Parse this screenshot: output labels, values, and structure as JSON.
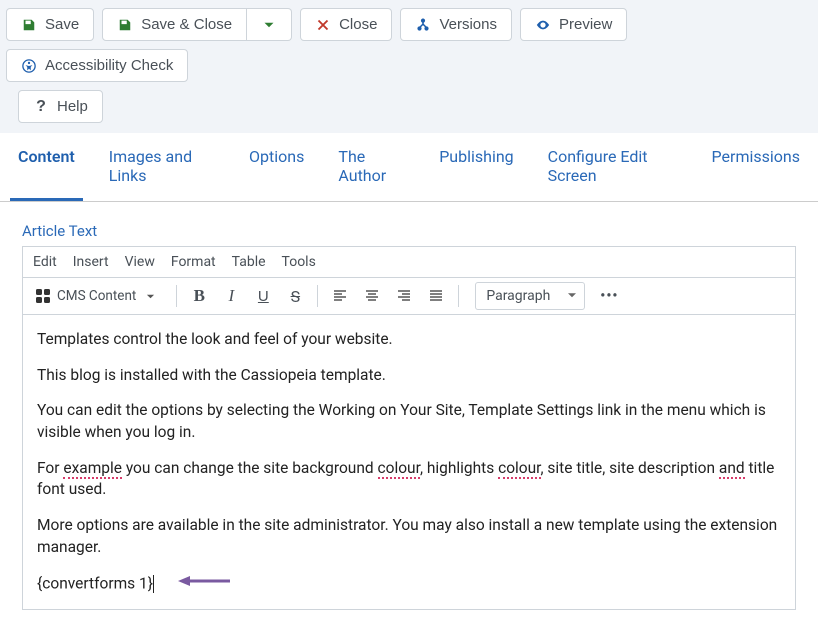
{
  "toolbar": {
    "save": "Save",
    "saveclose": "Save & Close",
    "close": "Close",
    "versions": "Versions",
    "preview": "Preview",
    "accessibility": "Accessibility Check",
    "help": "Help"
  },
  "tabs": {
    "content": "Content",
    "images": "Images and Links",
    "options": "Options",
    "author": "The Author",
    "publishing": "Publishing",
    "configure": "Configure Edit Screen",
    "permissions": "Permissions"
  },
  "editor": {
    "fieldLabel": "Article Text",
    "menu": {
      "edit": "Edit",
      "insert": "Insert",
      "view": "View",
      "format": "Format",
      "table": "Table",
      "tools": "Tools"
    },
    "cmsContent": "CMS Content",
    "paragraph": "Paragraph",
    "body": {
      "p1": "Templates control the look and feel of your website.",
      "p2": "This blog is installed with the Cassiopeia template.",
      "p3a": "You can edit the options by selecting the Working on Your Site, Template Settings link in the menu which is visible when you log in.",
      "p4_pre": "For ",
      "p4_err1": "example",
      "p4_mid1": " you can change the site background ",
      "p4_err2": "colour",
      "p4_mid2": ", highlights ",
      "p4_err3": "colour",
      "p4_mid3": ", site title, site description ",
      "p4_err4": "and",
      "p4_post": " title font used.",
      "p5": "More options are available in the site administrator. You may also install a new template using the extension manager.",
      "p6": "{convertforms 1}"
    }
  }
}
